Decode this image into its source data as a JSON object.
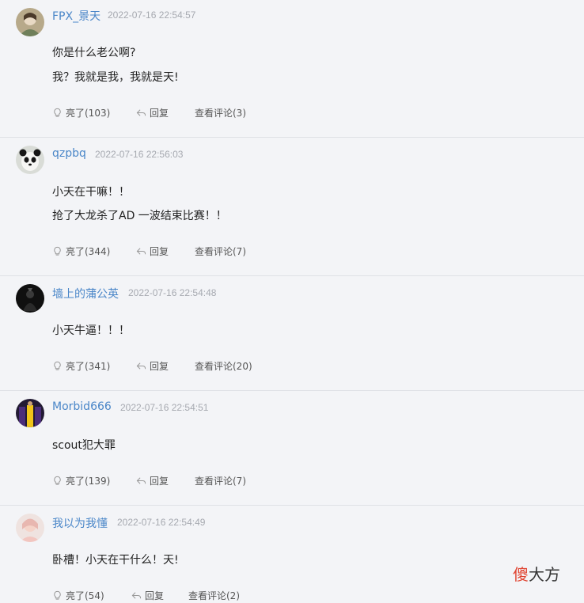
{
  "comments": [
    {
      "username": "FPX_景天",
      "time": "2022-07-16 22:54:57",
      "lines": [
        "你是什么老公啊?",
        "我？我就是我，我就是天!"
      ],
      "like": "亮了(103)",
      "reply": "回复",
      "view": "查看评论(3)"
    },
    {
      "username": "qzpbq",
      "time": "2022-07-16 22:56:03",
      "lines": [
        "小天在干嘛！！",
        "抢了大龙杀了AD 一波结束比赛！！"
      ],
      "like": "亮了(344)",
      "reply": "回复",
      "view": "查看评论(7)"
    },
    {
      "username": "墙上的蒲公英",
      "time": "2022-07-16 22:54:48",
      "lines": [
        "小天牛逼！！！"
      ],
      "like": "亮了(341)",
      "reply": "回复",
      "view": "查看评论(20)"
    },
    {
      "username": "Morbid666",
      "time": "2022-07-16 22:54:51",
      "lines": [
        "scout犯大罪"
      ],
      "like": "亮了(139)",
      "reply": "回复",
      "view": "查看评论(7)"
    },
    {
      "username": "我以为我懂",
      "time": "2022-07-16 22:54:49",
      "lines": [
        "卧槽！小天在干什么！天!"
      ],
      "like": "亮了(54)",
      "reply": "回复",
      "view": "查看评论(2)"
    }
  ],
  "watermark": {
    "first": "傻",
    "rest": "大方"
  },
  "icons": {
    "like": "light-bulb-icon",
    "reply": "reply-arrow-icon"
  },
  "colors": {
    "username": "#4a86c8",
    "timestamp": "#a6a9b0",
    "background": "#f3f4f7",
    "watermark_accent": "#e04330"
  }
}
